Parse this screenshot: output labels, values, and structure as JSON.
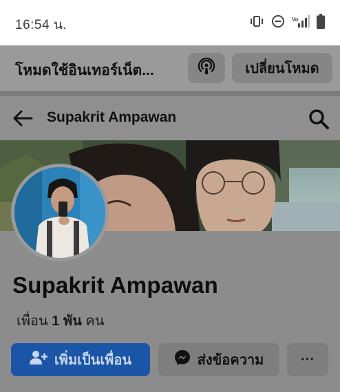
{
  "status_bar": {
    "time": "16:54 น.",
    "icons": [
      "vibrate-icon",
      "do-not-disturb-icon",
      "wifi-calling-signal-icon",
      "battery-icon"
    ]
  },
  "mode_bar": {
    "title": "โหมดใช้อินเทอร์เน็ต...",
    "mode_icon": "podcast-broadcast-icon",
    "switch_label": "เปลี่ยนโหมด"
  },
  "header": {
    "title": "Supakrit Ampawan",
    "back_icon": "back-arrow-icon",
    "search_icon": "search-icon"
  },
  "profile": {
    "name": "Supakrit Ampawan",
    "friends_prefix": "เพื่อน",
    "friends_count": "1 พัน",
    "friends_suffix": "คน"
  },
  "actions": {
    "add_friend_label": "เพิ่มเป็นเพื่อน",
    "message_label": "ส่งข้อความ",
    "more_label": "···"
  },
  "colors": {
    "primary_button": "#1b55a8",
    "overlay_gray": "#8c8c8c"
  }
}
